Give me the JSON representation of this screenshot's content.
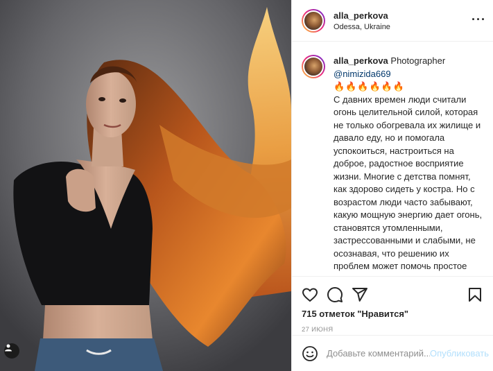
{
  "post": {
    "username": "alla_perkova",
    "location": "Odessa, Ukraine"
  },
  "caption": {
    "username": "alla_perkova",
    "role": "Photographer",
    "mention": "@nimizida669",
    "emoji": "🔥🔥🔥🔥🔥🔥",
    "text": "С давних времен люди считали огонь целительной силой, которая не только обогревала их жилище и давало еду, но и помогала успокоиться, настроиться на доброе, радостное восприятие жизни. Многие с детства помнят, как здорово сидеть у костра. Но с возрастом люди часто забывают, какую мощную энергию дает огонь, становятся утомленными, застрессованными и слабыми, не осознавая, что решению их проблем может помочь простое прирученное пламя.\n\nогонь — природная стихия, а"
  },
  "actions": {
    "like_icon": "heart-icon",
    "comment_icon": "comment-icon",
    "share_icon": "paper-plane-icon",
    "save_icon": "bookmark-icon"
  },
  "likes_text": "715 отметок \"Нравится\"",
  "date_text": "27 ИЮНЯ",
  "comment_box": {
    "placeholder": "Добавьте комментарий...",
    "publish_label": "Опубликовать"
  },
  "colors": {
    "text": "#262626",
    "secondary": "#8e8e8e",
    "link": "#00376b",
    "publish_disabled": "#b2dffc",
    "divider": "#efefef"
  }
}
